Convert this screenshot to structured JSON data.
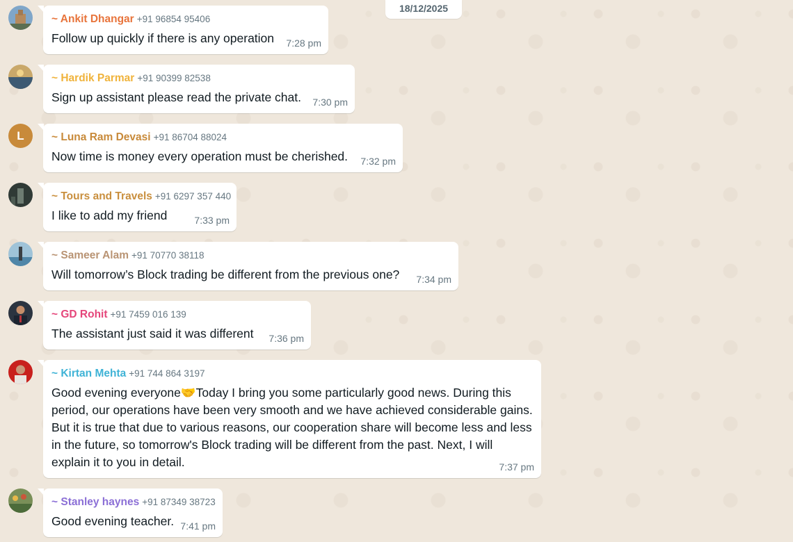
{
  "chat": {
    "date_chip": "18/12/2025",
    "messages": [
      {
        "sender": "~ Ankit Dhangar",
        "phone": "+91 96854 95406",
        "text": "Follow up quickly if there is any operation",
        "time": "7:28 pm",
        "name_color": "#e8743b"
      },
      {
        "sender": "~ Hardik Parmar",
        "phone": "+91 90399 82538",
        "text": "Sign up assistant please read the private chat.",
        "time": "7:30 pm",
        "name_color": "#f0b33c"
      },
      {
        "sender": "~ Luna Ram Devasi",
        "phone": "+91 86704 88024",
        "text": "Now time is money every operation must be cherished.",
        "time": "7:32 pm",
        "name_color": "#c88a3a",
        "avatar_letter": "L"
      },
      {
        "sender": "~ Tours and Travels",
        "phone": "+91 6297 357 440",
        "text": "I like to add my friend",
        "time": "7:33 pm",
        "name_color": "#c98f3e"
      },
      {
        "sender": "~ Sameer Alam",
        "phone": "+91 70770 38118",
        "text": "Will tomorrow’s Block trading be different from the previous one?",
        "time": "7:34 pm",
        "name_color": "#b99474"
      },
      {
        "sender": "~ GD Rohit",
        "phone": "+91 7459 016 139",
        "text": "The assistant just said it was different",
        "time": "7:36 pm",
        "name_color": "#e5457a"
      },
      {
        "sender": "~ Kirtan Mehta",
        "phone": "+91 744 864 3197",
        "text": "Good evening everyone🤝Today I bring you some particularly good news. During this period, our operations have been very smooth and we have achieved considerable gains. But it is true that due to various reasons, our cooperation share will become less and less in the future, so tomorrow's Block trading will be different from the past. Next, I will explain it to you in detail.",
        "time": "7:37 pm",
        "name_color": "#3fb3d6"
      },
      {
        "sender": "~ Stanley haynes",
        "phone": "+91 87349 38723",
        "text": "Good evening teacher.",
        "time": "7:41 pm",
        "name_color": "#8b6fd6"
      }
    ]
  }
}
